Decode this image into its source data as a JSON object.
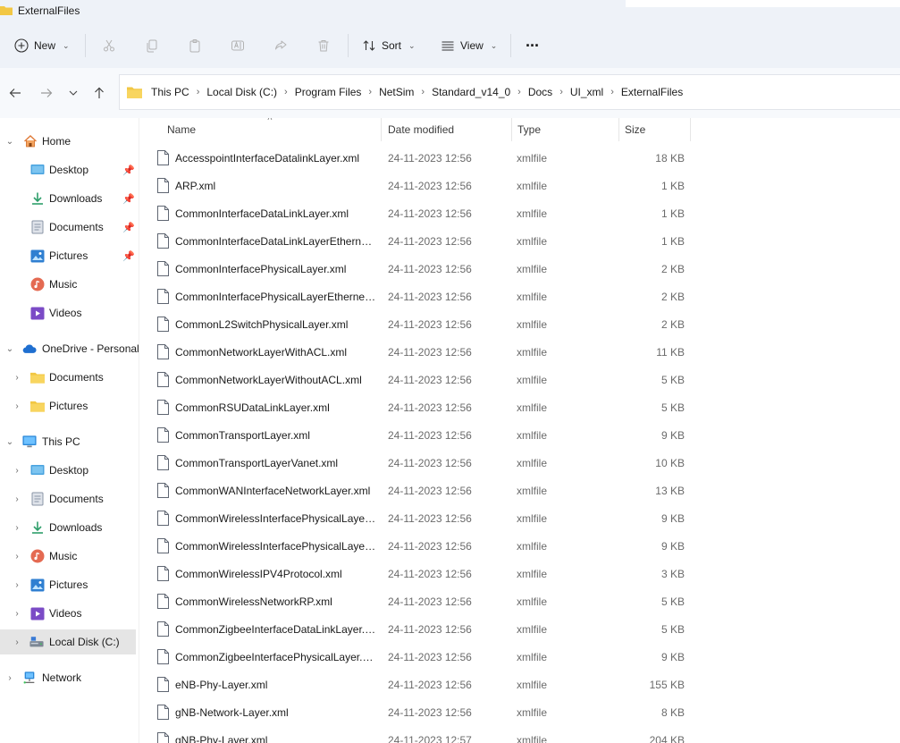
{
  "window": {
    "title": "ExternalFiles"
  },
  "toolbar": {
    "new_label": "New",
    "sort_label": "Sort",
    "view_label": "View",
    "more_glyph": "···"
  },
  "address": {
    "crumbs": [
      "This PC",
      "Local Disk (C:)",
      "Program Files",
      "NetSim",
      "Standard_v14_0",
      "Docs",
      "UI_xml",
      "ExternalFiles"
    ]
  },
  "sidebar": {
    "home": "Home",
    "quick": [
      {
        "label": "Desktop",
        "icon": "desktop-icon"
      },
      {
        "label": "Downloads",
        "icon": "downloads-icon"
      },
      {
        "label": "Documents",
        "icon": "documents-icon"
      },
      {
        "label": "Pictures",
        "icon": "pictures-icon"
      },
      {
        "label": "Music",
        "icon": "music-icon"
      },
      {
        "label": "Videos",
        "icon": "videos-icon"
      }
    ],
    "onedrive": "OneDrive - Personal",
    "onedrive_items": [
      "Documents",
      "Pictures"
    ],
    "thispc": "This PC",
    "thispc_items": [
      "Desktop",
      "Documents",
      "Downloads",
      "Music",
      "Pictures",
      "Videos",
      "Local Disk (C:)"
    ],
    "network": "Network"
  },
  "columns": {
    "name": "Name",
    "date": "Date modified",
    "type": "Type",
    "size": "Size"
  },
  "files": [
    {
      "name": "AccesspointInterfaceDatalinkLayer.xml",
      "date": "24-11-2023 12:56",
      "type": "xmlfile",
      "size": "18 KB"
    },
    {
      "name": "ARP.xml",
      "date": "24-11-2023 12:56",
      "type": "xmlfile",
      "size": "1 KB"
    },
    {
      "name": "CommonInterfaceDataLinkLayer.xml",
      "date": "24-11-2023 12:56",
      "type": "xmlfile",
      "size": "1 KB"
    },
    {
      "name": "CommonInterfaceDataLinkLayerEthernet...",
      "date": "24-11-2023 12:56",
      "type": "xmlfile",
      "size": "1 KB"
    },
    {
      "name": "CommonInterfacePhysicalLayer.xml",
      "date": "24-11-2023 12:56",
      "type": "xmlfile",
      "size": "2 KB"
    },
    {
      "name": "CommonInterfacePhysicalLayerEthernet...",
      "date": "24-11-2023 12:56",
      "type": "xmlfile",
      "size": "2 KB"
    },
    {
      "name": "CommonL2SwitchPhysicalLayer.xml",
      "date": "24-11-2023 12:56",
      "type": "xmlfile",
      "size": "2 KB"
    },
    {
      "name": "CommonNetworkLayerWithACL.xml",
      "date": "24-11-2023 12:56",
      "type": "xmlfile",
      "size": "11 KB"
    },
    {
      "name": "CommonNetworkLayerWithoutACL.xml",
      "date": "24-11-2023 12:56",
      "type": "xmlfile",
      "size": "5 KB"
    },
    {
      "name": "CommonRSUDataLinkLayer.xml",
      "date": "24-11-2023 12:56",
      "type": "xmlfile",
      "size": "5 KB"
    },
    {
      "name": "CommonTransportLayer.xml",
      "date": "24-11-2023 12:56",
      "type": "xmlfile",
      "size": "9 KB"
    },
    {
      "name": "CommonTransportLayerVanet.xml",
      "date": "24-11-2023 12:56",
      "type": "xmlfile",
      "size": "10 KB"
    },
    {
      "name": "CommonWANInterfaceNetworkLayer.xml",
      "date": "24-11-2023 12:56",
      "type": "xmlfile",
      "size": "13 KB"
    },
    {
      "name": "CommonWirelessInterfacePhysicalLayer....",
      "date": "24-11-2023 12:56",
      "type": "xmlfile",
      "size": "9 KB"
    },
    {
      "name": "CommonWirelessInterfacePhysicalLayer...",
      "date": "24-11-2023 12:56",
      "type": "xmlfile",
      "size": "9 KB"
    },
    {
      "name": "CommonWirelessIPV4Protocol.xml",
      "date": "24-11-2023 12:56",
      "type": "xmlfile",
      "size": "3 KB"
    },
    {
      "name": "CommonWirelessNetworkRP.xml",
      "date": "24-11-2023 12:56",
      "type": "xmlfile",
      "size": "5 KB"
    },
    {
      "name": "CommonZigbeeInterfaceDataLinkLayer.x...",
      "date": "24-11-2023 12:56",
      "type": "xmlfile",
      "size": "5 KB"
    },
    {
      "name": "CommonZigbeeInterfacePhysicalLayer.x...",
      "date": "24-11-2023 12:56",
      "type": "xmlfile",
      "size": "9 KB"
    },
    {
      "name": "eNB-Phy-Layer.xml",
      "date": "24-11-2023 12:56",
      "type": "xmlfile",
      "size": "155 KB"
    },
    {
      "name": "gNB-Network-Layer.xml",
      "date": "24-11-2023 12:56",
      "type": "xmlfile",
      "size": "8 KB"
    },
    {
      "name": "gNB-Phy-Layer.xml",
      "date": "24-11-2023 12:57",
      "type": "xmlfile",
      "size": "204 KB"
    }
  ],
  "colors": {
    "chrome": "#eef2f8",
    "folder": "#f2c744",
    "selection": "#e5e5e5"
  }
}
